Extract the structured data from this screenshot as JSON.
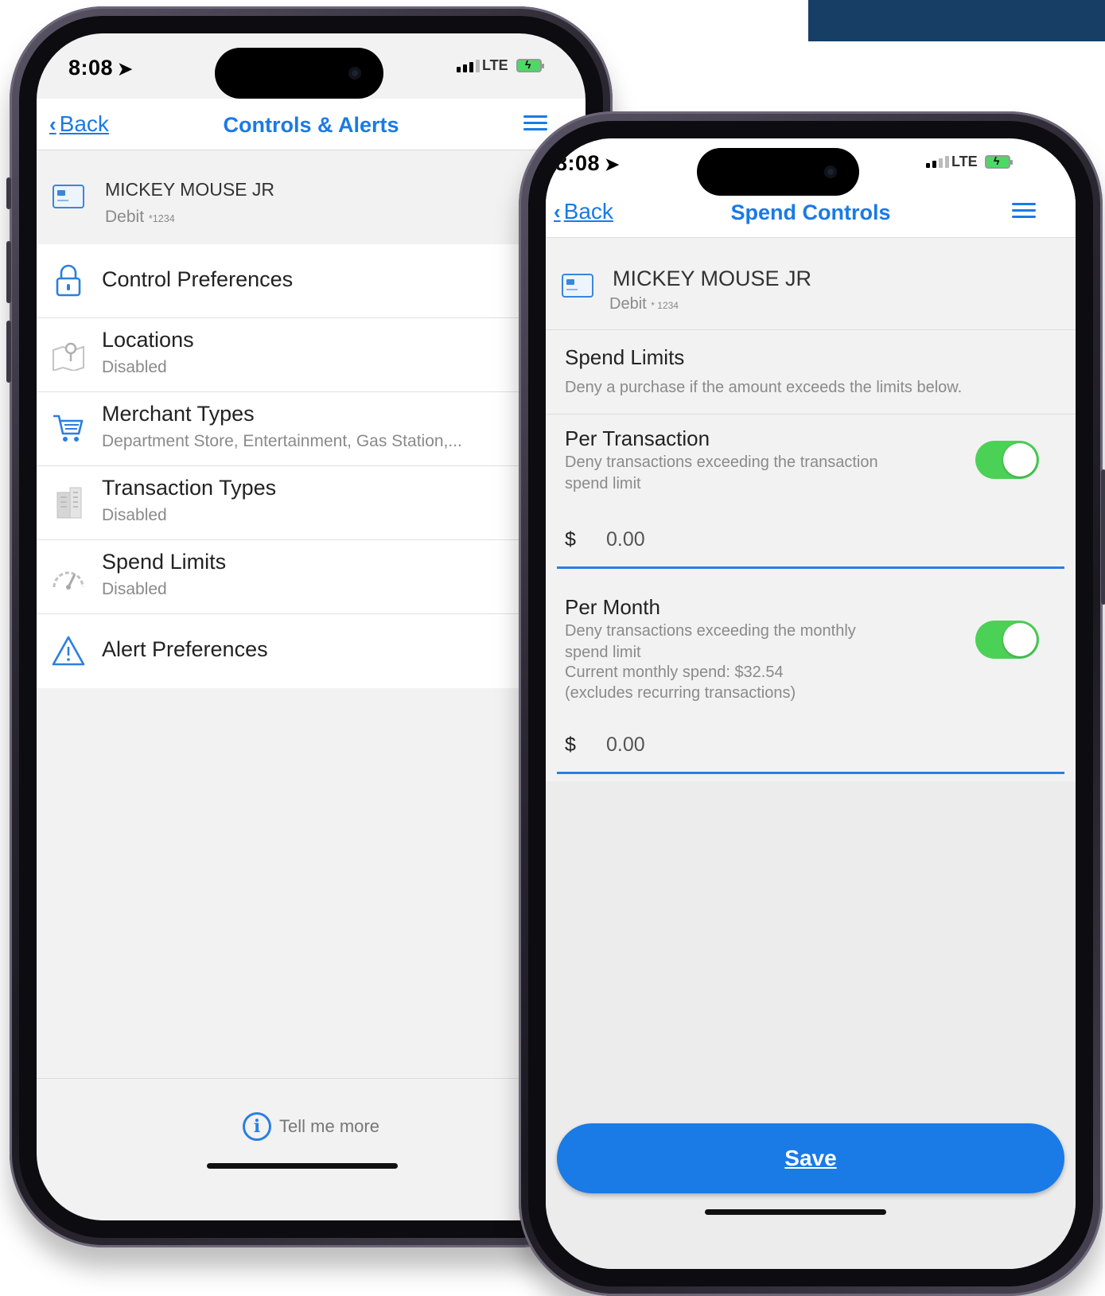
{
  "phone1": {
    "status": {
      "time": "8:08",
      "network": "LTE"
    },
    "nav": {
      "back_label": "Back",
      "title": "Controls & Alerts"
    },
    "card": {
      "name": "MICKEY MOUSE JR",
      "type": "Debit",
      "mask": "*1234"
    },
    "items": [
      {
        "label": "Control Preferences",
        "icon": "lock-icon"
      },
      {
        "label": "Locations",
        "sub": "Disabled",
        "icon": "map-pin-icon"
      },
      {
        "label": "Merchant Types",
        "sub": "Department Store, Entertainment, Gas Station,...",
        "icon": "cart-icon"
      },
      {
        "label": "Transaction Types",
        "sub": "Disabled",
        "icon": "building-icon"
      },
      {
        "label": "Spend Limits",
        "sub": "Disabled",
        "icon": "gauge-icon"
      },
      {
        "label": "Alert Preferences",
        "icon": "warning-icon"
      }
    ],
    "footer": {
      "tell_me_more": "Tell me more"
    }
  },
  "phone2": {
    "status": {
      "time": "8:08",
      "network": "LTE"
    },
    "nav": {
      "back_label": "Back",
      "title": "Spend Controls"
    },
    "card": {
      "name": "MICKEY MOUSE JR",
      "type": "Debit",
      "mask": "* 1234"
    },
    "spend_limits": {
      "title": "Spend Limits",
      "description": "Deny a purchase if the amount exceeds the limits below."
    },
    "per_transaction": {
      "title": "Per Transaction",
      "description_line1": "Deny transactions exceeding the transaction",
      "description_line2": "spend limit",
      "enabled": true,
      "currency": "$",
      "amount": "0.00"
    },
    "per_month": {
      "title": "Per Month",
      "description_line1": "Deny transactions exceeding the monthly",
      "description_line2": "spend limit",
      "current_spend": "Current monthly spend: $32.54",
      "note": "(excludes recurring transactions)",
      "enabled": true,
      "currency": "$",
      "amount": "0.00"
    },
    "save_label": "Save"
  },
  "colors": {
    "accent": "#1a7ae6",
    "toggle_on": "#4cd157",
    "banner": "#173f66"
  }
}
